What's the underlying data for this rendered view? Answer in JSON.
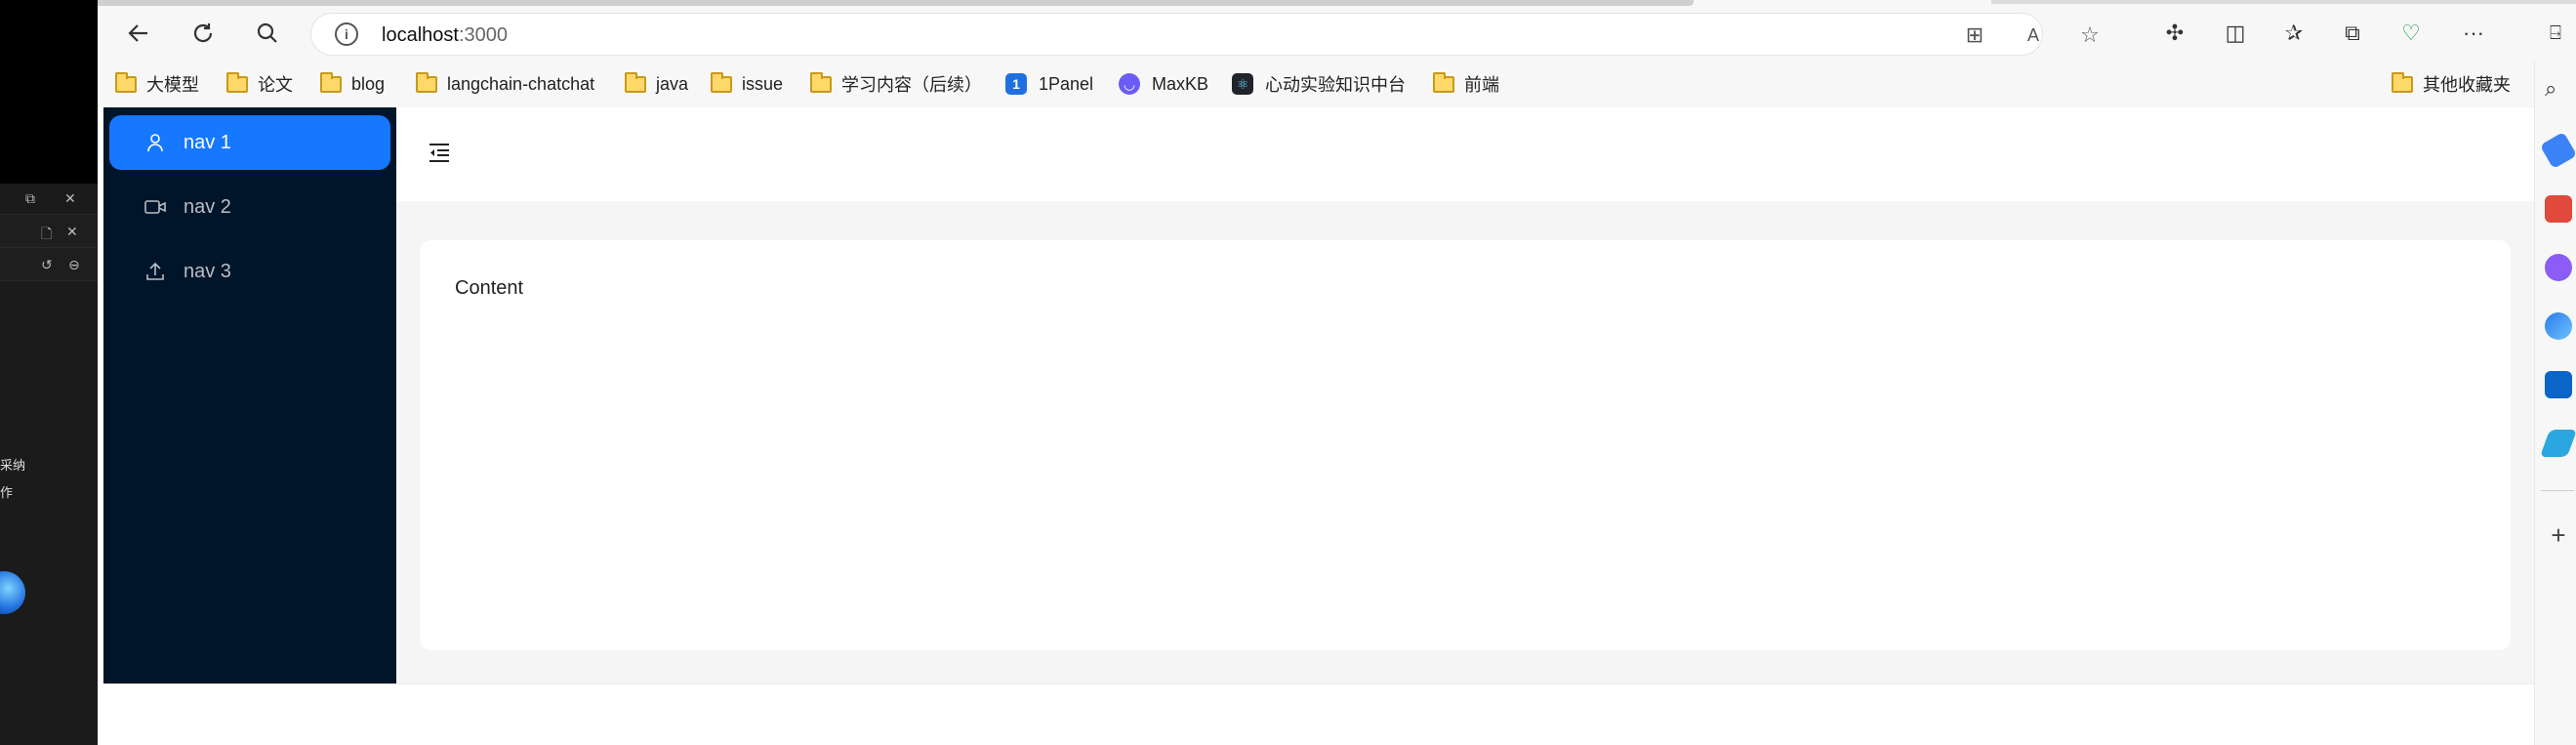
{
  "browser": {
    "url_host": "localhost",
    "url_port": ":3000",
    "nav": {
      "back_icon": "arrow-left-icon",
      "refresh_icon": "refresh-icon",
      "search_icon": "search-icon"
    }
  },
  "bookmarks": [
    {
      "label": "大模型",
      "icon": "folder"
    },
    {
      "label": "论文",
      "icon": "folder"
    },
    {
      "label": "blog",
      "icon": "folder"
    },
    {
      "label": "langchain-chatchat",
      "icon": "folder"
    },
    {
      "label": "java",
      "icon": "folder"
    },
    {
      "label": "issue",
      "icon": "folder"
    },
    {
      "label": "学习内容（后续）",
      "icon": "folder"
    },
    {
      "label": "1Panel",
      "icon": "1panel"
    },
    {
      "label": "MaxKB",
      "icon": "maxkb"
    },
    {
      "label": "心动实验知识中台",
      "icon": "react"
    },
    {
      "label": "前端",
      "icon": "folder"
    }
  ],
  "bookmarks_other": "其他收藏夹",
  "left_panel": {
    "text1": "采纳",
    "text2": "作"
  },
  "sider": {
    "items": [
      {
        "label": "nav 1",
        "icon": "user-icon",
        "active": true
      },
      {
        "label": "nav 2",
        "icon": "video-camera-icon",
        "active": false
      },
      {
        "label": "nav 3",
        "icon": "upload-icon",
        "active": false
      }
    ]
  },
  "main": {
    "content_text": "Content"
  },
  "colors": {
    "sider_bg": "#001529",
    "active_item": "#1677ff",
    "layout_bg": "#f5f5f5"
  }
}
